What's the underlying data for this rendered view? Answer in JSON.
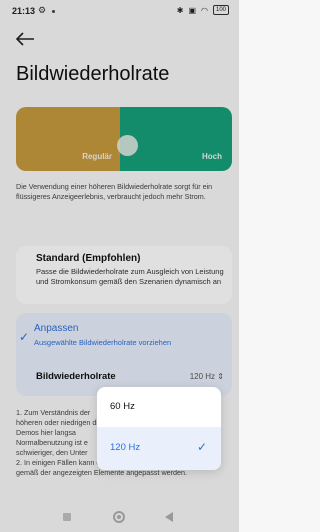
{
  "status_bar": {
    "time": "21:13",
    "right_icons": [
      "bluetooth-icon",
      "signal-icon",
      "wifi-icon",
      "battery-icon"
    ],
    "battery": "100"
  },
  "header": {
    "back_icon": "arrow-left-icon",
    "title": "Bildwiederholrate"
  },
  "preview": {
    "left_label": "Regulär",
    "right_label": "Hoch",
    "left_color": "#c59a3d",
    "right_color": "#16a07a",
    "slider_position": 0.5
  },
  "description": "Die Verwendung einer höheren Bildwiederholrate sorgt für ein flüssigeres Anzeigeerlebnis, verbraucht jedoch mehr Strom.",
  "options": {
    "standard": {
      "title": "Standard (Empfohlen)",
      "subtitle": "Passe die Bildwiederholrate zum Ausgleich von Leistung und Stromkonsum gemäß den Szenarien dynamisch an"
    },
    "custom": {
      "title": "Anpassen",
      "subtitle": "Ausgewählte Bildwiederholrate vorziehen",
      "row_label": "Bildwiederholrate",
      "row_value": "120 Hz"
    }
  },
  "notes": {
    "part1": "1. Zum Verständnis der höheren oder niedrigen die Demos hier langsa Normalbenutzung ist e schwieriger, den Unter",
    "part2": "2. In einigen Fällen kann die Bildwiederholrate dynamisch und gemäß der angezeigten Elemente angepasst werden."
  },
  "dropdown": {
    "items": [
      {
        "label": "60 Hz",
        "selected": false
      },
      {
        "label": "120 Hz",
        "selected": true
      }
    ],
    "accent": "#2f6fd8"
  }
}
